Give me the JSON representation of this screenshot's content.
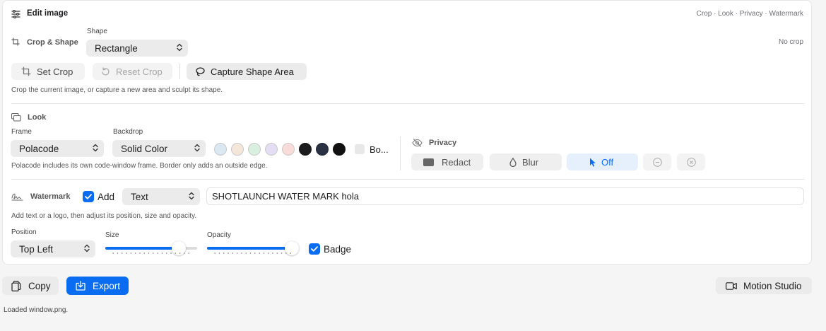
{
  "header": {
    "title": "Edit image",
    "breadcrumb": "Crop · Look · Privacy · Watermark"
  },
  "crop": {
    "section_title": "Crop & Shape",
    "shape_label": "Shape",
    "shape_value": "Rectangle",
    "status": "No crop",
    "set_crop": "Set Crop",
    "reset_crop": "Reset Crop",
    "capture": "Capture Shape Area",
    "hint": "Crop the current image, or capture a new area and sculpt its shape."
  },
  "look": {
    "section_title": "Look",
    "frame_label": "Frame",
    "frame_value": "Polacode",
    "backdrop_label": "Backdrop",
    "backdrop_value": "Solid Color",
    "swatches": [
      "#dbe7f1",
      "#f5e6da",
      "#d9efdf",
      "#e4ddf3",
      "#f8dcda",
      "#1c1c1e",
      "#2a3142",
      "#111111"
    ],
    "border_label": "Bo...",
    "hint": "Polacode includes its own code-window frame. Border only adds an outside edge."
  },
  "privacy": {
    "section_title": "Privacy",
    "redact": "Redact",
    "blur": "Blur",
    "off": "Off"
  },
  "watermark": {
    "section_title": "Watermark",
    "add_label": "Add",
    "type_value": "Text",
    "text_value": "SHOTLAUNCH WATER MARK hola",
    "hint": "Add text or a logo, then adjust its position, size and opacity.",
    "position_label": "Position",
    "position_value": "Top Left",
    "size_label": "Size",
    "size_level": 0.8,
    "opacity_label": "Opacity",
    "opacity_level": 0.92,
    "badge_label": "Badge"
  },
  "footer": {
    "copy": "Copy",
    "export": "Export",
    "motion": "Motion Studio",
    "status": "Loaded window.png."
  },
  "colors": {
    "accent": "#0a6cf0",
    "selected_bg": "#e6f0fd"
  }
}
